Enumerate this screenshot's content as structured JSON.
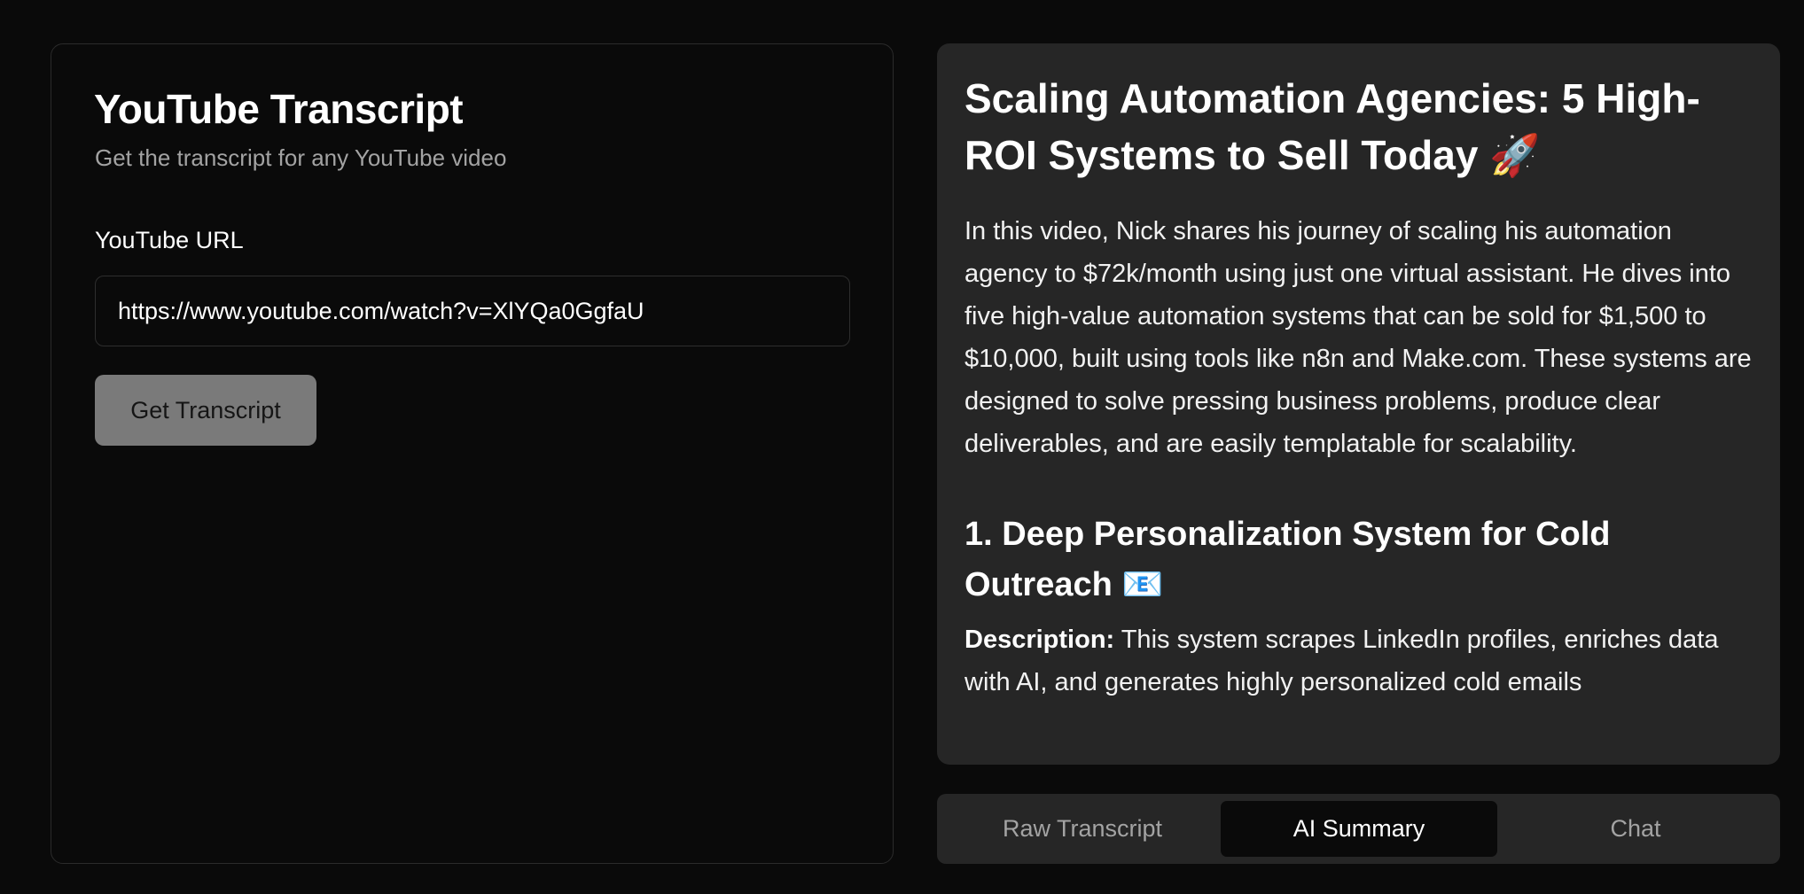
{
  "left_panel": {
    "title": "YouTube Transcript",
    "subtitle": "Get the transcript for any YouTube video",
    "url_label": "YouTube URL",
    "url_value": "https://www.youtube.com/watch?v=XlYQa0GgfaU",
    "button_label": "Get Transcript"
  },
  "summary": {
    "title": "Scaling Automation Agencies: 5 High-ROI Systems to Sell Today",
    "title_emoji": "🚀",
    "intro": "In this video, Nick shares his journey of scaling his automation agency to $72k/month using just one virtual assistant. He dives into five high-value automation systems that can be sold for $1,500 to $10,000, built using tools like n8n and Make.com. These systems are designed to solve pressing business problems, produce clear deliverables, and are easily templatable for scalability.",
    "section1_title": "1. Deep Personalization System for Cold Outreach",
    "section1_emoji": "📧",
    "section1_desc_label": "Description:",
    "section1_desc_text": " This system scrapes LinkedIn profiles, enriches data with AI, and generates highly personalized cold emails"
  },
  "tabs": [
    {
      "label": "Raw Transcript",
      "active": false
    },
    {
      "label": "AI Summary",
      "active": true
    },
    {
      "label": "Chat",
      "active": false
    }
  ],
  "colors": {
    "background": "#0a0a0a",
    "card": "#262626",
    "button": "#7a7a7a",
    "muted_text": "#a3a3a3"
  }
}
